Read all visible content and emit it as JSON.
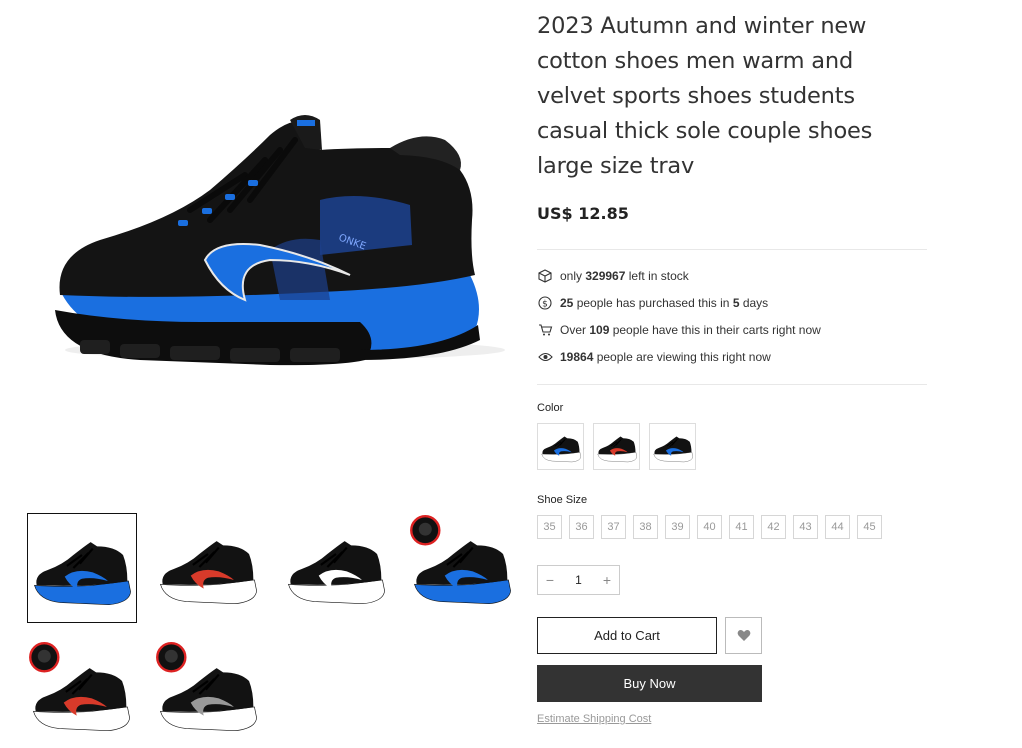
{
  "product": {
    "title_lines": [
      "2023 Autumn and winter new",
      "cotton shoes men warm and",
      "velvet sports shoes students",
      "casual thick sole couple shoes",
      "large size trav"
    ],
    "price": "US$ 12.85",
    "main_image": {
      "icon": "sneaker-black-blue",
      "sole_color": "#1a6fe0",
      "body_color": "#111111",
      "logo_text": "ONKE"
    }
  },
  "stats": {
    "stock": {
      "icon": "box-icon",
      "pre": "only ",
      "value": "329967",
      "post": " left in stock"
    },
    "purchased": {
      "icon": "dollar-icon",
      "value": "25",
      "mid": " people has purchased this in ",
      "days": "5",
      "post": " days"
    },
    "carts": {
      "icon": "cart-icon",
      "pre": "Over ",
      "value": "109",
      "post": " people have this in their carts right now"
    },
    "viewing": {
      "icon": "eye-icon",
      "value": "19864",
      "post": " people are viewing this right now"
    }
  },
  "options": {
    "color_label": "Color",
    "colors": [
      {
        "name": "black-blue",
        "accent": "#1a6fe0"
      },
      {
        "name": "black-red",
        "accent": "#d83a2a"
      },
      {
        "name": "black-blue-2",
        "accent": "#1a6fe0"
      }
    ],
    "size_label": "Shoe Size",
    "sizes": [
      "35",
      "36",
      "37",
      "38",
      "39",
      "40",
      "41",
      "42",
      "43",
      "44",
      "45"
    ]
  },
  "quantity": {
    "value": "1",
    "minus": "−",
    "plus": "+"
  },
  "buttons": {
    "add_to_cart": "Add to Cart",
    "buy_now": "Buy Now",
    "wishlist_icon": "heart-icon"
  },
  "links": {
    "estimate_shipping": "Estimate Shipping Cost"
  },
  "thumbnails": [
    {
      "name": "black-blue",
      "accent": "#1a6fe0",
      "sole": "#1a6fe0",
      "badge": false,
      "active": true
    },
    {
      "name": "black-red",
      "accent": "#d83a2a",
      "sole": "#ffffff",
      "badge": false,
      "active": false
    },
    {
      "name": "black-white",
      "accent": "#ffffff",
      "sole": "#ffffff",
      "badge": false,
      "active": false
    },
    {
      "name": "black-blue-badge",
      "accent": "#1a6fe0",
      "sole": "#1a6fe0",
      "badge": true,
      "active": false
    },
    {
      "name": "black-red-badge",
      "accent": "#d83a2a",
      "sole": "#ffffff",
      "badge": true,
      "active": false
    },
    {
      "name": "black-grey-badge",
      "accent": "#999999",
      "sole": "#ffffff",
      "badge": true,
      "active": false
    }
  ],
  "colors": {
    "accent": "#333333",
    "border": "#dddddd",
    "muted": "#999999"
  }
}
